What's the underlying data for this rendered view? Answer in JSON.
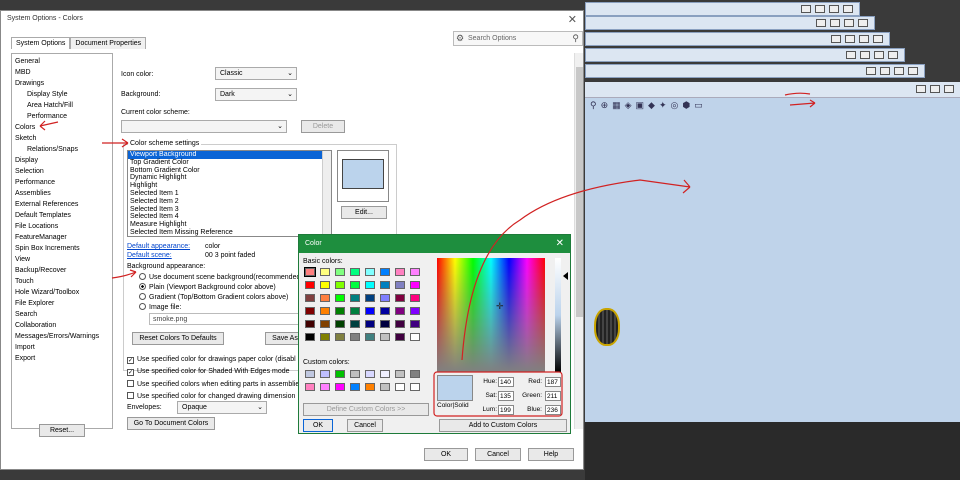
{
  "dialog": {
    "title": "System Options - Colors",
    "tabs": [
      "System Options",
      "Document Properties"
    ],
    "search_placeholder": "Search Options",
    "tree": [
      {
        "label": "General",
        "sub": false
      },
      {
        "label": "MBD",
        "sub": false
      },
      {
        "label": "Drawings",
        "sub": false
      },
      {
        "label": "Display Style",
        "sub": true
      },
      {
        "label": "Area Hatch/Fill",
        "sub": true
      },
      {
        "label": "Performance",
        "sub": true
      },
      {
        "label": "Colors",
        "sub": false
      },
      {
        "label": "Sketch",
        "sub": false
      },
      {
        "label": "Relations/Snaps",
        "sub": true
      },
      {
        "label": "Display",
        "sub": false
      },
      {
        "label": "Selection",
        "sub": false
      },
      {
        "label": "Performance",
        "sub": false
      },
      {
        "label": "Assemblies",
        "sub": false
      },
      {
        "label": "External References",
        "sub": false
      },
      {
        "label": "Default Templates",
        "sub": false
      },
      {
        "label": "File Locations",
        "sub": false
      },
      {
        "label": "FeatureManager",
        "sub": false
      },
      {
        "label": "Spin Box Increments",
        "sub": false
      },
      {
        "label": "View",
        "sub": false
      },
      {
        "label": "Backup/Recover",
        "sub": false
      },
      {
        "label": "Touch",
        "sub": false
      },
      {
        "label": "Hole Wizard/Toolbox",
        "sub": false
      },
      {
        "label": "File Explorer",
        "sub": false
      },
      {
        "label": "Search",
        "sub": false
      },
      {
        "label": "Collaboration",
        "sub": false
      },
      {
        "label": "Messages/Errors/Warnings",
        "sub": false
      },
      {
        "label": "Import",
        "sub": false
      },
      {
        "label": "Export",
        "sub": false
      }
    ],
    "reset_label": "Reset...",
    "ok_label": "OK",
    "cancel_label": "Cancel",
    "help_label": "Help"
  },
  "colors_page": {
    "icon_color_label": "Icon color:",
    "icon_color_value": "Classic",
    "background_label": "Background:",
    "background_value": "Dark",
    "current_scheme_label": "Current color scheme:",
    "delete_label": "Delete",
    "scheme_settings_label": "Color scheme settings",
    "scheme_items": [
      "Viewport Background",
      "Top Gradient Color",
      "Bottom Gradient Color",
      "Dynamic Highlight",
      "Highlight",
      "Selected Item 1",
      "Selected Item 2",
      "Selected Item 3",
      "Selected Item 4",
      "Measure Highlight",
      "Selected Item Missing Reference"
    ],
    "edit_label": "Edit...",
    "default_appearance_label": "Default appearance:",
    "default_appearance_value": "color",
    "default_scene_label": "Default scene:",
    "default_scene_value": "00 3 point faded",
    "bg_appearance_label": "Background appearance:",
    "radio_options": [
      "Use document scene background(recommended",
      "Plain (Viewport Background color above)",
      "Gradient (Top/Bottom Gradient colors above)",
      "Image file:"
    ],
    "image_file_value": "smoke.png",
    "reset_colors_label": "Reset Colors To Defaults",
    "save_as_label": "Save As",
    "checkboxes": [
      {
        "label": "Use specified color for drawings paper color (disabl",
        "checked": true
      },
      {
        "label": "Use specified color for Shaded With Edges mode",
        "checked": true
      },
      {
        "label": "Use specified colors when editing parts in assemblie",
        "checked": false
      },
      {
        "label": "Use specified color for changed drawing dimension",
        "checked": false
      }
    ],
    "envelopes_label": "Envelopes:",
    "envelopes_value": "Opaque",
    "goto_doc_colors_label": "Go To Document Colors"
  },
  "color_dialog": {
    "title": "Color",
    "basic_colors_label": "Basic colors:",
    "basic_colors": [
      "#ff8080",
      "#ffff80",
      "#80ff80",
      "#00ff80",
      "#80ffff",
      "#0080ff",
      "#ff80c0",
      "#ff80ff",
      "#ff0000",
      "#ffff00",
      "#80ff00",
      "#00ff40",
      "#00ffff",
      "#0080c0",
      "#8080c0",
      "#ff00ff",
      "#804040",
      "#ff8040",
      "#00ff00",
      "#008080",
      "#004080",
      "#8080ff",
      "#800040",
      "#ff0080",
      "#800000",
      "#ff8000",
      "#008000",
      "#008040",
      "#0000ff",
      "#0000a0",
      "#800080",
      "#8000ff",
      "#400000",
      "#804000",
      "#004000",
      "#004040",
      "#000080",
      "#000040",
      "#400040",
      "#400080",
      "#000000",
      "#808000",
      "#808040",
      "#808080",
      "#408080",
      "#c0c0c0",
      "#400040",
      "#ffffff"
    ],
    "custom_colors_label": "Custom colors:",
    "custom_colors": [
      "#c0c8e0",
      "#c0c0ff",
      "#00c000",
      "#c0c0c0",
      "#d8d8ff",
      "#f0f0ff",
      "#c0c0c0",
      "#808080",
      "#ff80c0",
      "#ff80ff",
      "#ff00ff",
      "#0080ff",
      "#ff8000",
      "#c0c0c0",
      "#ffffff",
      "#ffffff"
    ],
    "define_custom_label": "Define Custom Colors >>",
    "ok_label": "OK",
    "cancel_label": "Cancel",
    "color_solid_label": "Color|Solid",
    "hue_label": "Hue:",
    "hue": "140",
    "sat_label": "Sat:",
    "sat": "135",
    "lum_label": "Lum:",
    "lum": "199",
    "red_label": "Red:",
    "red": "187",
    "green_label": "Green:",
    "green": "211",
    "blue_label": "Blue:",
    "blue": "236",
    "add_custom_label": "Add to Custom Colors",
    "current_color": "#bbd3ec"
  },
  "colors": {
    "accent": "#1e8e3e",
    "selection": "#0a64d6",
    "annotation": "#d12222"
  }
}
